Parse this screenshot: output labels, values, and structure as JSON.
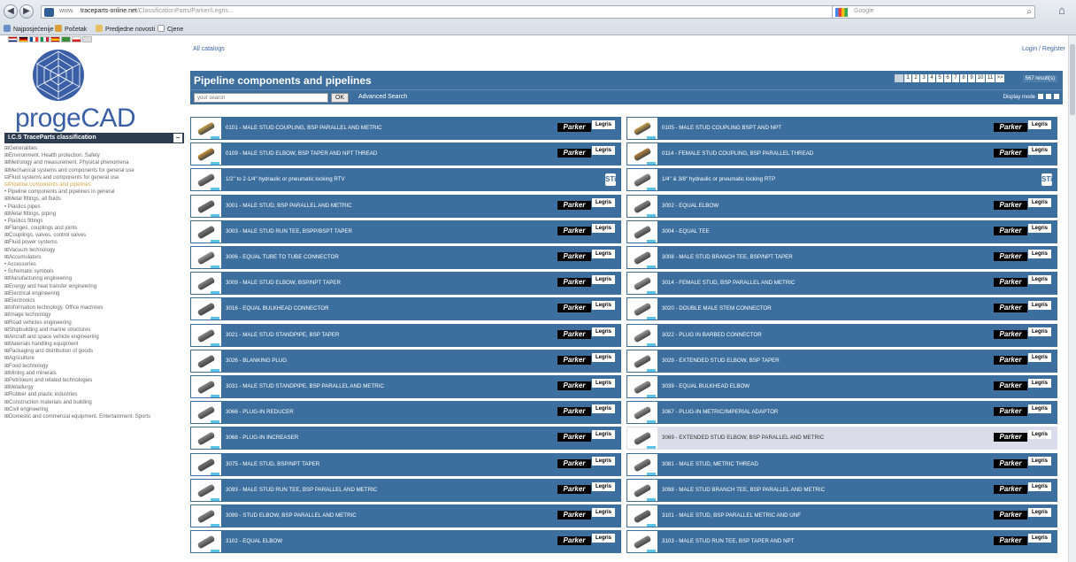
{
  "browser": {
    "url_host": "www.",
    "url_domain": "traceparts-online.net",
    "url_path": "/ClassificationParts/Parker/Legris...",
    "search_placeholder": "Google",
    "bookmarks": [
      "Najposjećenije",
      "Početak",
      "Predjedne novosti",
      "Cjene"
    ]
  },
  "sidebar": {
    "logo_text": "progeCAD",
    "classification_title": "I.C.S TraceParts classification",
    "close_label": "−",
    "tree": [
      {
        "label": "⊞Generalities",
        "hl": false
      },
      {
        "label": "⊞Environment. Health protection. Safety",
        "hl": false
      },
      {
        "label": "⊞Metrology and measurement. Physical phenomena",
        "hl": false
      },
      {
        "label": "⊞Mechanical systems and components for general use",
        "hl": false
      },
      {
        "label": "⊟Fluid systems and components for general use",
        "hl": false
      },
      {
        "label": "  ⊟Pipeline components and pipelines",
        "hl": true
      },
      {
        "label": "    • Pipeline components and pipelines in general",
        "hl": false
      },
      {
        "label": "    ⊞Metal fittings, all fluids",
        "hl": false
      },
      {
        "label": "    • Plastics pipes",
        "hl": false
      },
      {
        "label": "    ⊞Metal fittings, piping",
        "hl": false
      },
      {
        "label": "    • Plastics fittings",
        "hl": false
      },
      {
        "label": "    ⊞Flanges, couplings and joints",
        "hl": false
      },
      {
        "label": "  ⊞Couplings, valves, control valves",
        "hl": false
      },
      {
        "label": "  ⊞Fluid power systems",
        "hl": false
      },
      {
        "label": "  ⊞Vacuum technology",
        "hl": false
      },
      {
        "label": "  ⊞Accumulators",
        "hl": false
      },
      {
        "label": "  • Accessories",
        "hl": false
      },
      {
        "label": "  • Schematic symbols",
        "hl": false
      },
      {
        "label": "⊞Manufacturing engineering",
        "hl": false
      },
      {
        "label": "⊞Energy and heat transfer engineering",
        "hl": false
      },
      {
        "label": "⊞Electrical engineering",
        "hl": false
      },
      {
        "label": "⊞Electronics",
        "hl": false
      },
      {
        "label": "⊞Information technology. Office machines",
        "hl": false
      },
      {
        "label": "⊞Image technology",
        "hl": false
      },
      {
        "label": "⊞Road vehicles engineering",
        "hl": false
      },
      {
        "label": "⊞Shipbuilding and marine structures",
        "hl": false
      },
      {
        "label": "⊞Aircraft and space vehicle engineering",
        "hl": false
      },
      {
        "label": "⊞Materials handling equipment",
        "hl": false
      },
      {
        "label": "⊞Packaging and distribution of goods",
        "hl": false
      },
      {
        "label": "⊞Agriculture",
        "hl": false
      },
      {
        "label": "⊞Food technology",
        "hl": false
      },
      {
        "label": "⊞Mining and minerals",
        "hl": false
      },
      {
        "label": "⊞Petroleum and related technologies",
        "hl": false
      },
      {
        "label": "⊞Metallurgy",
        "hl": false
      },
      {
        "label": "⊞Rubber and plastic industries",
        "hl": false
      },
      {
        "label": "⊞Construction materials and building",
        "hl": false
      },
      {
        "label": "⊞Civil engineering",
        "hl": false
      },
      {
        "label": "⊞Domestic and commercial equipment. Entertainment. Sports",
        "hl": false
      }
    ]
  },
  "header": {
    "all_catalogs": "All catalogs",
    "login": "Login / Register",
    "title": "Pipeline components and pipelines",
    "pages": [
      "1",
      "2",
      "3",
      "4",
      "5",
      "6",
      "7",
      "8",
      "9",
      "10",
      "11",
      ">>"
    ],
    "results": "567 result(s)",
    "search_placeholder": "your search",
    "ok_label": "OK",
    "advanced_search": "Advanced Search",
    "display_mode": "Display mode"
  },
  "brand_labels": {
    "parker": "Parker",
    "legris": "Legris",
    "sti": "STi"
  },
  "products": [
    {
      "name": "0101 - MALE STUD COUPLING, BSP PARALLEL AND METRIC",
      "brand": "parker",
      "color": "#c8a14a"
    },
    {
      "name": "0105 - MALE STUD COUPLING BSPT AND NPT",
      "brand": "parker",
      "color": "#c8a14a"
    },
    {
      "name": "0109 - MALE STUD ELBOW, BSP TAPER AND NPT THREAD",
      "brand": "parker",
      "color": "#c8903a"
    },
    {
      "name": "0114 - FEMALE STUD COUPLING, BSP PARALLEL THREAD",
      "brand": "parker",
      "color": "#b8823a"
    },
    {
      "name": "1/2\" to 2-1/4\" hydraulic or pneumatic locking RTV",
      "brand": "sti",
      "color": "#888888"
    },
    {
      "name": "1/4\" & 3/8\" hydraulic or pneumatic locking RTP",
      "brand": "sti",
      "color": "#999999"
    },
    {
      "name": "3001 - MALE STUD, BSP PARALLEL AND METRIC",
      "brand": "parker",
      "color": "#777777"
    },
    {
      "name": "3002 - EQUAL ELBOW",
      "brand": "parker",
      "color": "#888888"
    },
    {
      "name": "3003 - MALE STUD RUN TEE, BSPP/BSPT TAPER",
      "brand": "parker",
      "color": "#777777"
    },
    {
      "name": "3004 - EQUAL TEE",
      "brand": "parker",
      "color": "#888888"
    },
    {
      "name": "3006 - EQUAL TUBE TO TUBE CONNECTOR",
      "brand": "parker",
      "color": "#999999"
    },
    {
      "name": "3008 - MALE STUD BRANCH TEE, BSP/NPT TAPER",
      "brand": "parker",
      "color": "#888888"
    },
    {
      "name": "3009 - MALE STUD ELBOW, BSP/NPT TAPER",
      "brand": "parker",
      "color": "#888888"
    },
    {
      "name": "3014 - FEMALE STUD, BSP PARALLEL AND METRIC",
      "brand": "parker",
      "color": "#999999"
    },
    {
      "name": "3016 - EQUAL BULKHEAD CONNECTOR",
      "brand": "parker",
      "color": "#777777"
    },
    {
      "name": "3020 - DOUBLE MALE STEM CONNECTOR",
      "brand": "parker",
      "color": "#999999"
    },
    {
      "name": "3021 - MALE STUD STANDPIPE, BSP TAPER",
      "brand": "parker",
      "color": "#888888"
    },
    {
      "name": "3022 - PLUG IN BARBED CONNECTOR",
      "brand": "parker",
      "color": "#999999"
    },
    {
      "name": "3026 - BLANKING PLUG",
      "brand": "parker",
      "color": "#777777"
    },
    {
      "name": "3029 - EXTENDED STUD ELBOW, BSP TAPER",
      "brand": "parker",
      "color": "#888888"
    },
    {
      "name": "3031 - MALE STUD STANDPIPE, BSP PARALLEL AND METRIC",
      "brand": "parker",
      "color": "#888888"
    },
    {
      "name": "3039 - EQUAL BULKHEAD ELBOW",
      "brand": "parker",
      "color": "#999999"
    },
    {
      "name": "3066 - PLUG-IN REDUCER",
      "brand": "parker",
      "color": "#888888"
    },
    {
      "name": "3067 - PLUG-IN METRIC/IMPERIAL ADAPTOR",
      "brand": "parker",
      "color": "#999999"
    },
    {
      "name": "3068 - PLUG-IN INCREASER",
      "brand": "parker",
      "color": "#888888"
    },
    {
      "name": "3069 - EXTENDED STUD ELBOW, BSP PARALLEL AND METRIC",
      "brand": "parker",
      "color": "#888888",
      "alt": true
    },
    {
      "name": "3075 - MALE STUD, BSP/NPT TAPER",
      "brand": "parker",
      "color": "#777777"
    },
    {
      "name": "3081 - MALE STUD, METRIC THREAD",
      "brand": "parker",
      "color": "#888888"
    },
    {
      "name": "3093 - MALE STUD RUN TEE, BSP PARALLEL AND METRIC",
      "brand": "parker",
      "color": "#888888"
    },
    {
      "name": "3098 - MALE STUD BRANCH TEE, BSP PARALLEL AND METRIC",
      "brand": "parker",
      "color": "#888888"
    },
    {
      "name": "3099 - STUD ELBOW, BSP PARALLEL AND METRIC",
      "brand": "parker",
      "color": "#888888"
    },
    {
      "name": "3101 - MALE STUD, BSP PARALLEL METRIC AND UNF",
      "brand": "parker",
      "color": "#777777"
    },
    {
      "name": "3102 - EQUAL ELBOW",
      "brand": "parker",
      "color": "#888888"
    },
    {
      "name": "3103 - MALE STUD RUN TEE, BSP TAPER AND NPT",
      "brand": "parker",
      "color": "#888888"
    }
  ]
}
